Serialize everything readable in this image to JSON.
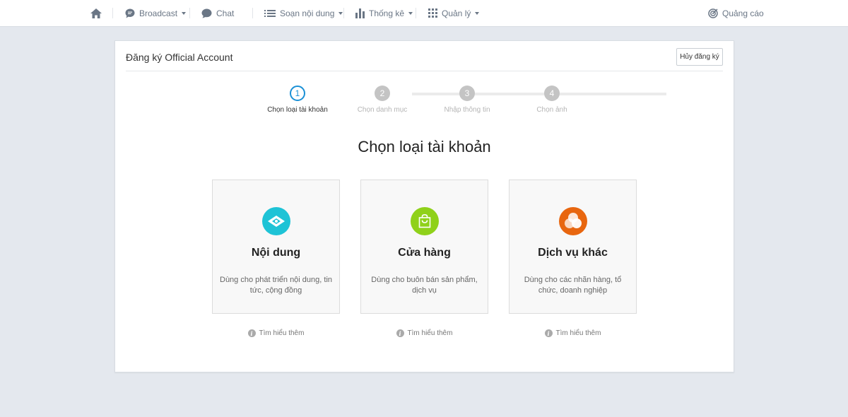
{
  "nav": {
    "home_icon": "home-icon",
    "broadcast": {
      "label": "Broadcast",
      "icon": "broadcast-chat-icon"
    },
    "chat": {
      "label": "Chat",
      "icon": "chat-bubble-icon"
    },
    "content": {
      "label": "Soạn nội dung",
      "icon": "list-icon"
    },
    "stats": {
      "label": "Thống kê",
      "icon": "bar-chart-icon"
    },
    "manage": {
      "label": "Quản lý",
      "icon": "grid-icon"
    },
    "ads": {
      "label": "Quảng cáo",
      "icon": "target-icon"
    }
  },
  "card": {
    "title": "Đăng ký Official Account",
    "cancel_label": "Hủy đăng ký"
  },
  "steps": [
    {
      "number": "1",
      "label": "Chọn loại tài khoản",
      "active": true
    },
    {
      "number": "2",
      "label": "Chọn danh mục",
      "active": false
    },
    {
      "number": "3",
      "label": "Nhập thông tin",
      "active": false
    },
    {
      "number": "4",
      "label": "Chọn ảnh",
      "active": false
    }
  ],
  "heading": "Chọn loại tài khoản",
  "options": [
    {
      "title": "Nội dung",
      "description": "Dùng cho phát triển nội dung, tin tức, cộng đồng",
      "icon": "content-eye-icon",
      "color": "#1ec3d6"
    },
    {
      "title": "Cửa hàng",
      "description": "Dùng cho buôn bán sản phẩm, dịch vụ",
      "icon": "shopping-bag-icon",
      "color": "#8fd11a"
    },
    {
      "title": "Dịch vụ khác",
      "description": "Dùng cho các nhãn hàng, tổ chức, doanh nghiệp",
      "icon": "circles-icon",
      "color": "#e8660f"
    }
  ],
  "learn_more": "Tìm hiểu thêm",
  "colors": {
    "accent": "#1a90d6",
    "background": "#e4e8ee"
  }
}
